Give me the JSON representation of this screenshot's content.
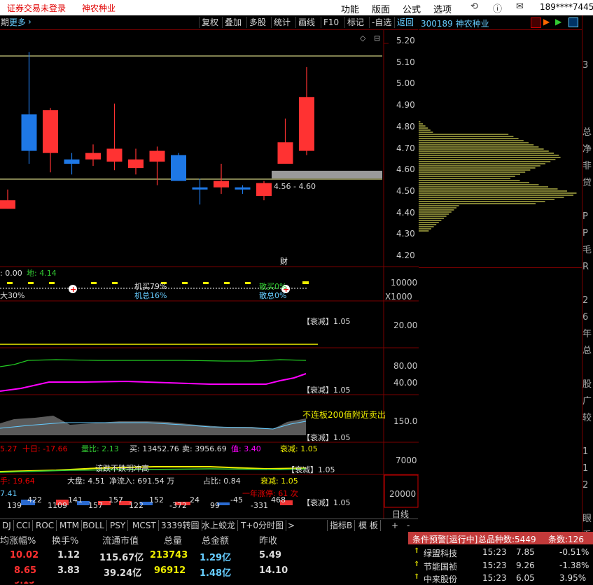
{
  "topbar": {
    "status": "证券交易未登录",
    "stock_name": "神农种业",
    "menu": [
      "功能",
      "版面",
      "公式",
      "选项"
    ],
    "account": "189****7445"
  },
  "toolbar": {
    "left_label": "期",
    "more": "更多",
    "buttons": [
      "复权",
      "叠加",
      "多股",
      "统计",
      "画线",
      "F10",
      "标记",
      "-自选",
      "返回"
    ]
  },
  "right_header": {
    "code_name": "300189 神农种业"
  },
  "price_axis": [
    "5.20",
    "5.10",
    "5.00",
    "4.90",
    "4.80",
    "4.70",
    "4.60",
    "4.50",
    "4.40",
    "4.30",
    "4.20"
  ],
  "range_label": "4.56 - 4.60",
  "cai_badge": "财",
  "ind1": {
    "left": ": 0.00",
    "di": "地: 4.14",
    "small_labels": [
      "机买79%",
      "机总16%",
      "散买0%",
      "散总0%"
    ],
    "left2": "大30%",
    "axis": "10000",
    "scale": "X1000"
  },
  "ind2": {
    "label": "【衰减】1.05",
    "axis": "20.00"
  },
  "ind3": {
    "label": "【衰减】1.05",
    "axis": [
      "80.00",
      "40.00"
    ]
  },
  "ind4": {
    "note": "不连板200值附近卖出",
    "label": "【衰减】1.05",
    "axis": "150.0"
  },
  "ind5": {
    "row": [
      "5.27",
      "十日: -17.66",
      "量比: 2.13",
      "买: 13452.76",
      "卖: 3956.69",
      "值: 3.40",
      "衰减: 1.05"
    ],
    "axis": "7000",
    "overlay": "该跌不跌明冲高",
    "label": "【衰减】1.05"
  },
  "ind6": {
    "row": [
      "手: 19.64",
      "大盘: 4.51",
      "净流入: 691.54 万",
      "占比: 0.84",
      "衰减: 1.05"
    ],
    "left2": "7.41",
    "nums": [
      "139",
      "422",
      "1109",
      "141",
      "157",
      "157",
      "122",
      "152",
      "-372",
      "24",
      "99",
      "-45",
      "-331",
      "468"
    ],
    "note": "一年涨停: 61 次",
    "label": "【衰减】1.05",
    "axis": "20000",
    "ri": "日线"
  },
  "bottom_tabs": [
    "DJ",
    "CCI",
    "ROC",
    "MTM",
    "BOLL",
    "PSY",
    "MCST",
    "3339转圆",
    "水上蛟龙",
    "T+0分时图",
    ">"
  ],
  "bottom_right": [
    "指标B",
    "模 板",
    "+",
    "-"
  ],
  "table": {
    "headers": [
      "均涨幅%",
      "换手%",
      "流通市值",
      "总量",
      "总金额",
      "昨收"
    ],
    "rows": [
      [
        "10.02",
        "1.12",
        "115.67亿",
        "213743",
        "1.29亿",
        "5.49"
      ],
      [
        "8.65",
        "3.83",
        "39.24亿",
        "96912",
        "1.48亿",
        "14.10"
      ]
    ]
  },
  "alert": {
    "title": "条件预警[运行中]",
    "count_text": "总品种数:5449",
    "n_text": "条数:126",
    "rows": [
      [
        "绿盟科技",
        "15:23",
        "7.85",
        "-0.51%"
      ],
      [
        "节能国祯",
        "15:23",
        "9.26",
        "-1.38%"
      ],
      [
        "中来股份",
        "15:23",
        "6.05",
        "3.95%"
      ]
    ]
  },
  "chart_data": {
    "type": "candlestick",
    "ylim": [
      4.15,
      5.25
    ],
    "candles": [
      {
        "o": 4.42,
        "c": 4.46,
        "h": 4.51,
        "l": 4.42
      },
      {
        "o": 4.86,
        "c": 4.69,
        "h": 5.15,
        "l": 4.63
      },
      {
        "o": 4.68,
        "c": 4.88,
        "h": 4.89,
        "l": 4.59
      },
      {
        "o": 4.65,
        "c": 4.63,
        "h": 4.68,
        "l": 4.58
      },
      {
        "o": 4.65,
        "c": 4.68,
        "h": 4.72,
        "l": 4.62
      },
      {
        "o": 4.64,
        "c": 4.7,
        "h": 4.91,
        "l": 4.6
      },
      {
        "o": 4.61,
        "c": 4.65,
        "h": 4.7,
        "l": 4.58
      },
      {
        "o": 4.64,
        "c": 4.69,
        "h": 4.71,
        "l": 4.53
      },
      {
        "o": 4.67,
        "c": 4.55,
        "h": 4.68,
        "l": 4.55
      },
      {
        "o": 4.52,
        "c": 4.51,
        "h": 4.56,
        "l": 4.44
      },
      {
        "o": 4.52,
        "c": 4.55,
        "h": 4.63,
        "l": 4.49
      },
      {
        "o": 4.52,
        "c": 4.51,
        "h": 4.53,
        "l": 4.49
      },
      {
        "o": 4.48,
        "c": 4.54,
        "h": 4.55,
        "l": 4.46
      },
      {
        "o": 4.63,
        "c": 4.73,
        "h": 4.84,
        "l": 4.63
      },
      {
        "o": 4.69,
        "c": 4.94,
        "h": 5.08,
        "l": 4.67
      }
    ]
  }
}
